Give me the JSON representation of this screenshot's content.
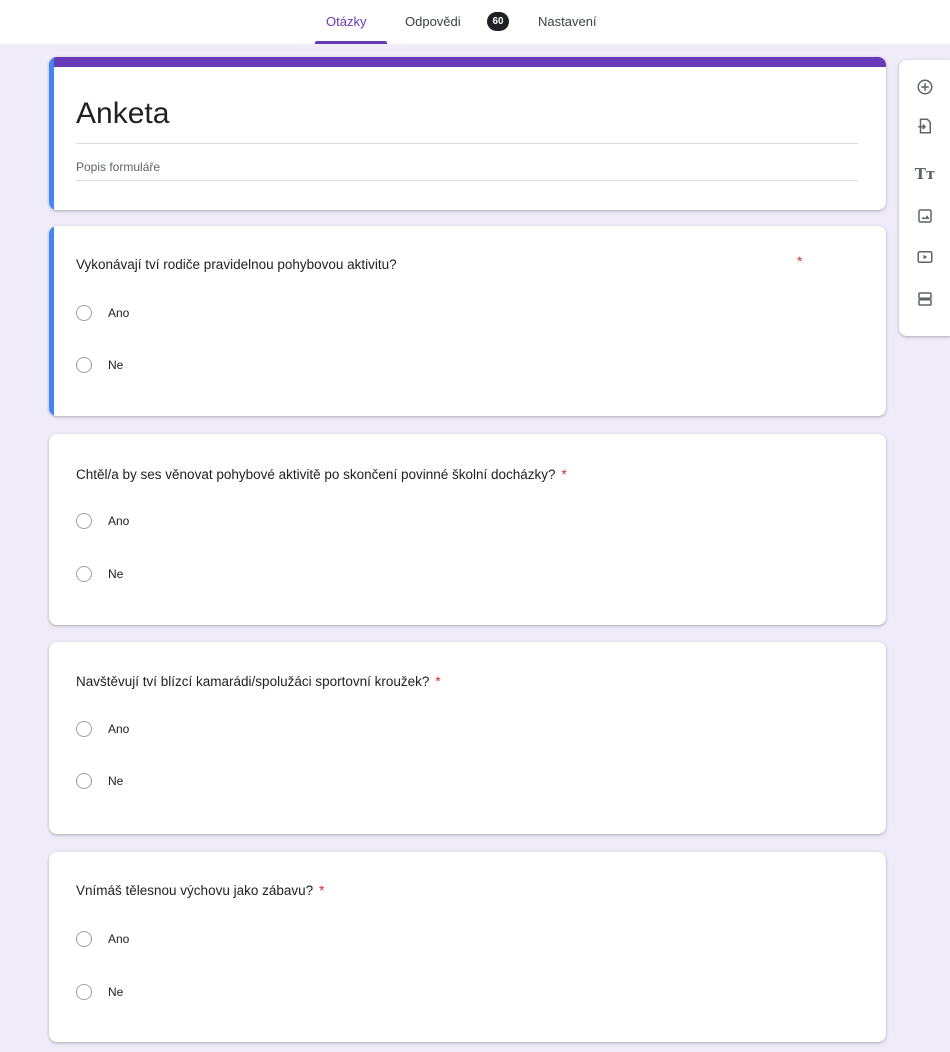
{
  "tabs": {
    "questions": "Otázky",
    "responses": "Odpovědi",
    "responses_count": "60",
    "settings": "Nastavení"
  },
  "form": {
    "title": "Anketa",
    "description": "Popis formuláře"
  },
  "required_mark": "*",
  "questions": [
    {
      "text": "Vykonávají tví rodiče pravidelnou pohybovou aktivitu?",
      "options": [
        "Ano",
        "Ne"
      ]
    },
    {
      "text": "Chtěl/a by ses věnovat pohybové aktivitě po skončení povinné školní docházky?",
      "options": [
        "Ano",
        "Ne"
      ]
    },
    {
      "text": "Navštěvují tví blízcí kamarádi/spolužáci sportovní kroužek?",
      "options": [
        "Ano",
        "Ne"
      ]
    },
    {
      "text": "Vnímáš tělesnou výchovu jako zábavu?",
      "options": [
        "Ano",
        "Ne"
      ]
    }
  ],
  "toolbar": {
    "add_question_icon": "add-circle-icon",
    "import_icon": "import-questions-icon",
    "title_text_label": "Tт",
    "image_icon": "image-icon",
    "video_icon": "video-icon",
    "section_icon": "section-icon"
  },
  "colors": {
    "accent": "#673ab7",
    "active_card": "#4285f4",
    "required": "#d93025",
    "background": "#f0ebf8"
  }
}
